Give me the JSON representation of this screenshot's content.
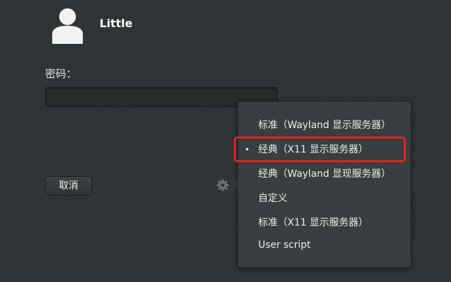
{
  "user": {
    "name": "Little",
    "avatar_icon": "user-avatar-icon"
  },
  "login": {
    "password_label": "密码：",
    "password_value": "",
    "cancel_label": "取消"
  },
  "session_button": {
    "icon": "gear-icon"
  },
  "session_menu": {
    "items": [
      {
        "label": "标准（Wayland 显示服务器）",
        "bullet": ""
      },
      {
        "label": "经典（X11 显示服务器）",
        "bullet": "•"
      },
      {
        "label": "经典（Wayland 显现服务器）",
        "bullet": ""
      },
      {
        "label": "自定义",
        "bullet": ""
      },
      {
        "label": "标准（X11 显示服务器）",
        "bullet": ""
      },
      {
        "label": "User script",
        "bullet": ""
      }
    ]
  },
  "colors": {
    "background": "#2e3436",
    "menu_background": "#393e40",
    "text": "#eeeeec",
    "annotation": "#e8201a"
  }
}
